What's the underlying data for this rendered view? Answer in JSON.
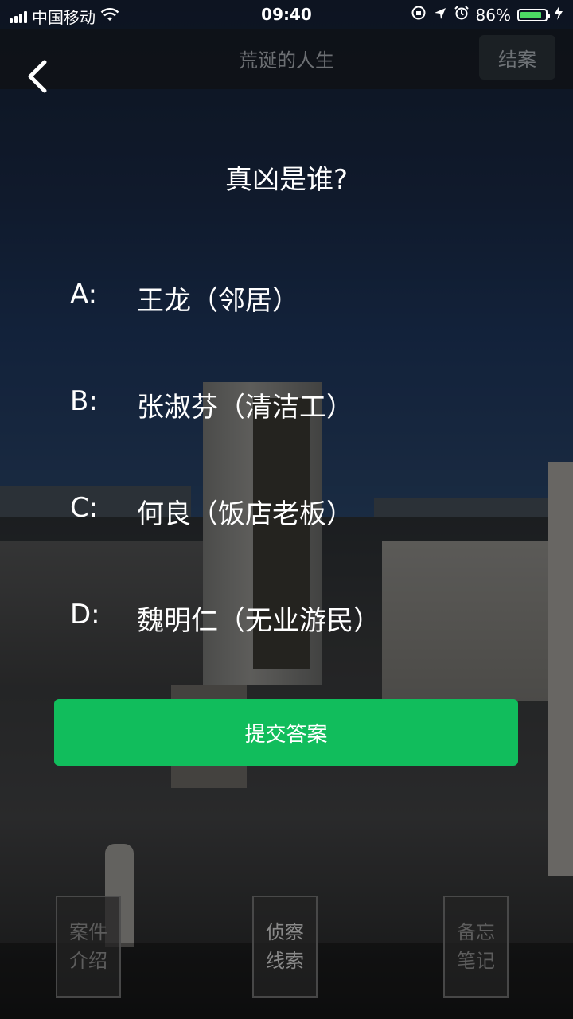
{
  "status_bar": {
    "carrier": "中国移动",
    "time": "09:40",
    "battery_percent": "86%",
    "battery_level": 0.86,
    "icons": [
      "signal-icon",
      "wifi-icon",
      "orientation-lock-icon",
      "location-icon",
      "alarm-icon",
      "battery-icon",
      "charging-icon"
    ]
  },
  "nav": {
    "title": "荒诞的人生",
    "close_case_label": "结案"
  },
  "quiz": {
    "question": "真凶是谁?",
    "options": [
      {
        "letter": "A:",
        "text": "王龙（邻居）"
      },
      {
        "letter": "B:",
        "text": "张淑芬（清洁工）"
      },
      {
        "letter": "C:",
        "text": "何良（饭店老板）"
      },
      {
        "letter": "D:",
        "text": "魏明仁（无业游民）"
      }
    ],
    "submit_label": "提交答案"
  },
  "tabs": [
    {
      "line1": "案件",
      "line2": "介绍"
    },
    {
      "line1": "侦察",
      "line2": "线索"
    },
    {
      "line1": "备忘",
      "line2": "笔记"
    }
  ],
  "colors": {
    "accent": "#11bd5c",
    "battery": "#4cd964"
  }
}
